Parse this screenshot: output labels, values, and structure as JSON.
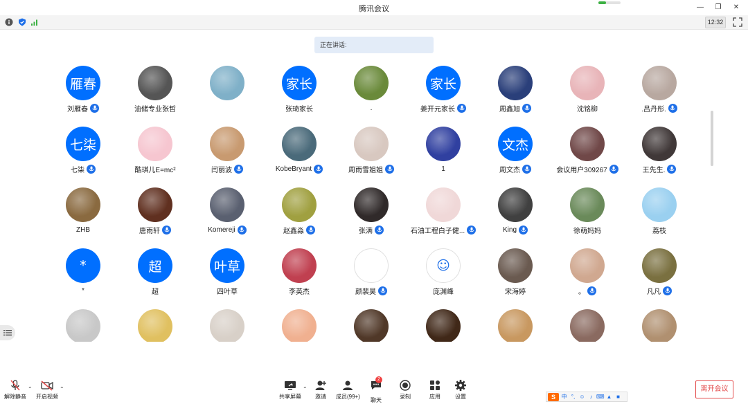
{
  "window": {
    "title": "腾讯会议"
  },
  "status": {
    "time": "12:32"
  },
  "speaking": {
    "label": "正在讲话:"
  },
  "participants": [
    {
      "name": "刘雁春",
      "avatar_text": "雁春",
      "mic": true,
      "color": "#006fff"
    },
    {
      "name": "油储专业张哲",
      "avatar_text": "",
      "mic": false,
      "color": "#555555"
    },
    {
      "name": "",
      "avatar_text": "",
      "mic": false,
      "color": "#7fb0c8"
    },
    {
      "name": "张琦家长",
      "avatar_text": "家长",
      "mic": false,
      "color": "#006fff"
    },
    {
      "name": ".",
      "avatar_text": "",
      "mic": false,
      "color": "#6a8a3a"
    },
    {
      "name": "姜开元家长",
      "avatar_text": "家长",
      "mic": true,
      "color": "#006fff"
    },
    {
      "name": "周鑫旭",
      "avatar_text": "",
      "mic": true,
      "color": "#2a3f7a"
    },
    {
      "name": "沈铭柳",
      "avatar_text": "",
      "mic": false,
      "color": "#e8b4b8"
    },
    {
      "name": ".吕丹彤.",
      "avatar_text": "",
      "mic": true,
      "color": "#b8a8a0"
    },
    {
      "name": "七柒",
      "avatar_text": "七柒",
      "mic": true,
      "color": "#006fff"
    },
    {
      "name": "酷琪儿E=mc²",
      "avatar_text": "",
      "mic": false,
      "color": "#f6c6d0"
    },
    {
      "name": "闫丽波",
      "avatar_text": "",
      "mic": true,
      "color": "#c89a70"
    },
    {
      "name": "KobeBryant",
      "avatar_text": "",
      "mic": true,
      "color": "#4a6a7a"
    },
    {
      "name": "周雨雪姐姐",
      "avatar_text": "",
      "mic": true,
      "color": "#d8c8c0"
    },
    {
      "name": "1",
      "avatar_text": "",
      "mic": false,
      "color": "#3040a0"
    },
    {
      "name": "周文杰",
      "avatar_text": "文杰",
      "mic": true,
      "color": "#006fff"
    },
    {
      "name": "会议用户309267",
      "avatar_text": "",
      "mic": true,
      "color": "#704848"
    },
    {
      "name": "王先生.",
      "avatar_text": "",
      "mic": true,
      "color": "#403838"
    },
    {
      "name": "ZHB",
      "avatar_text": "",
      "mic": false,
      "color": "#8a6a40"
    },
    {
      "name": "唐雨轩",
      "avatar_text": "",
      "mic": true,
      "color": "#603020"
    },
    {
      "name": "Komereji",
      "avatar_text": "",
      "mic": true,
      "color": "#5a6070"
    },
    {
      "name": "赵鑫淼",
      "avatar_text": "",
      "mic": true,
      "color": "#a0a040"
    },
    {
      "name": "张满",
      "avatar_text": "",
      "mic": true,
      "color": "#302a2a"
    },
    {
      "name": "石油工程白子健...",
      "avatar_text": "",
      "mic": true,
      "color": "#f0d8d8"
    },
    {
      "name": "King",
      "avatar_text": "",
      "mic": true,
      "color": "#404040"
    },
    {
      "name": "徐萌妈妈",
      "avatar_text": "",
      "mic": false,
      "color": "#6a8a5a"
    },
    {
      "name": "荔枝",
      "avatar_text": "",
      "mic": false,
      "color": "#9ad0f0"
    },
    {
      "name": "*",
      "avatar_text": "*",
      "mic": false,
      "color": "#006fff"
    },
    {
      "name": "超",
      "avatar_text": "超",
      "mic": false,
      "color": "#006fff"
    },
    {
      "name": "四叶草",
      "avatar_text": "叶草",
      "mic": false,
      "color": "#006fff"
    },
    {
      "name": "李英杰",
      "avatar_text": "",
      "mic": false,
      "color": "#c04050"
    },
    {
      "name": "颜裴昊",
      "avatar_text": "",
      "mic": true,
      "color": "#ffffff"
    },
    {
      "name": "庞渊峰",
      "avatar_text": "☺",
      "mic": false,
      "color": "#ffffff"
    },
    {
      "name": "宋海婷",
      "avatar_text": "",
      "mic": false,
      "color": "#6a5a50"
    },
    {
      "name": "。",
      "avatar_text": "",
      "mic": true,
      "color": "#d0a890"
    },
    {
      "name": "凡凡",
      "avatar_text": "",
      "mic": true,
      "color": "#7a7040"
    },
    {
      "name": "",
      "avatar_text": "",
      "mic": false,
      "color": "#c8c8c8"
    },
    {
      "name": "",
      "avatar_text": "",
      "mic": false,
      "color": "#e0c060"
    },
    {
      "name": "",
      "avatar_text": "",
      "mic": false,
      "color": "#d8d0c8"
    },
    {
      "name": "",
      "avatar_text": "",
      "mic": false,
      "color": "#f0b090"
    },
    {
      "name": "",
      "avatar_text": "",
      "mic": false,
      "color": "#503828"
    },
    {
      "name": "",
      "avatar_text": "",
      "mic": false,
      "color": "#402818"
    },
    {
      "name": "",
      "avatar_text": "",
      "mic": false,
      "color": "#c89860"
    },
    {
      "name": "",
      "avatar_text": "",
      "mic": false,
      "color": "#8a6a60"
    },
    {
      "name": "",
      "avatar_text": "",
      "mic": false,
      "color": "#b09070"
    }
  ],
  "toolbar": {
    "unmute": "解除静音",
    "start_video": "开启视频",
    "share_screen": "共享屏幕",
    "invite": "邀请",
    "members": "成员(99+)",
    "chat": "聊天",
    "chat_badge": "2",
    "record": "录制",
    "apps": "应用",
    "settings": "设置",
    "leave": "离开会议"
  },
  "ime": {
    "logo": "S",
    "lang": "中"
  }
}
